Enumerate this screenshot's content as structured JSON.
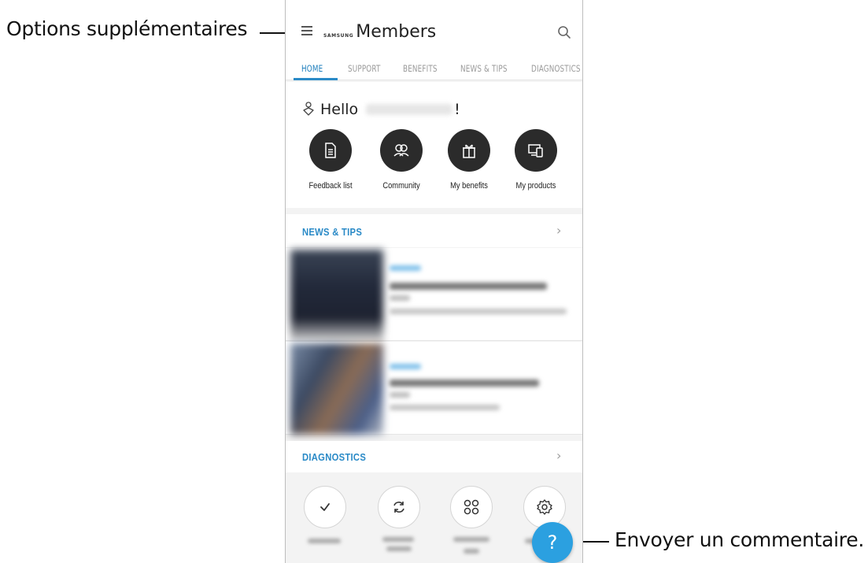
{
  "callouts": {
    "menu": "Options supplémentaires",
    "feedback": "Envoyer un commentaire."
  },
  "app": {
    "brand_small": "SAMSUNG",
    "brand_name": "Members"
  },
  "tabs": [
    {
      "label": "HOME",
      "active": true
    },
    {
      "label": "SUPPORT",
      "active": false
    },
    {
      "label": "BENEFITS",
      "active": false
    },
    {
      "label": "NEWS & TIPS",
      "active": false
    },
    {
      "label": "DIAGNOSTICS",
      "active": false
    }
  ],
  "greeting": {
    "prefix": "Hello",
    "suffix": "!"
  },
  "quick_actions": [
    {
      "label": "Feedback list",
      "icon": "document-icon"
    },
    {
      "label": "Community",
      "icon": "people-icon"
    },
    {
      "label": "My benefits",
      "icon": "gift-icon"
    },
    {
      "label": "My products",
      "icon": "devices-icon"
    }
  ],
  "news": {
    "title": "NEWS & TIPS",
    "chevron": "›"
  },
  "diagnostics": {
    "title": "DIAGNOSTICS",
    "chevron": "›",
    "icons": [
      "check-icon",
      "refresh-icon",
      "apps-grid-icon",
      "settings-gear-icon"
    ]
  },
  "fab": {
    "label": "?"
  },
  "colors": {
    "accent": "#2a8ac7",
    "fab": "#2ba0e0",
    "icon_bg": "#2b2b2b"
  }
}
